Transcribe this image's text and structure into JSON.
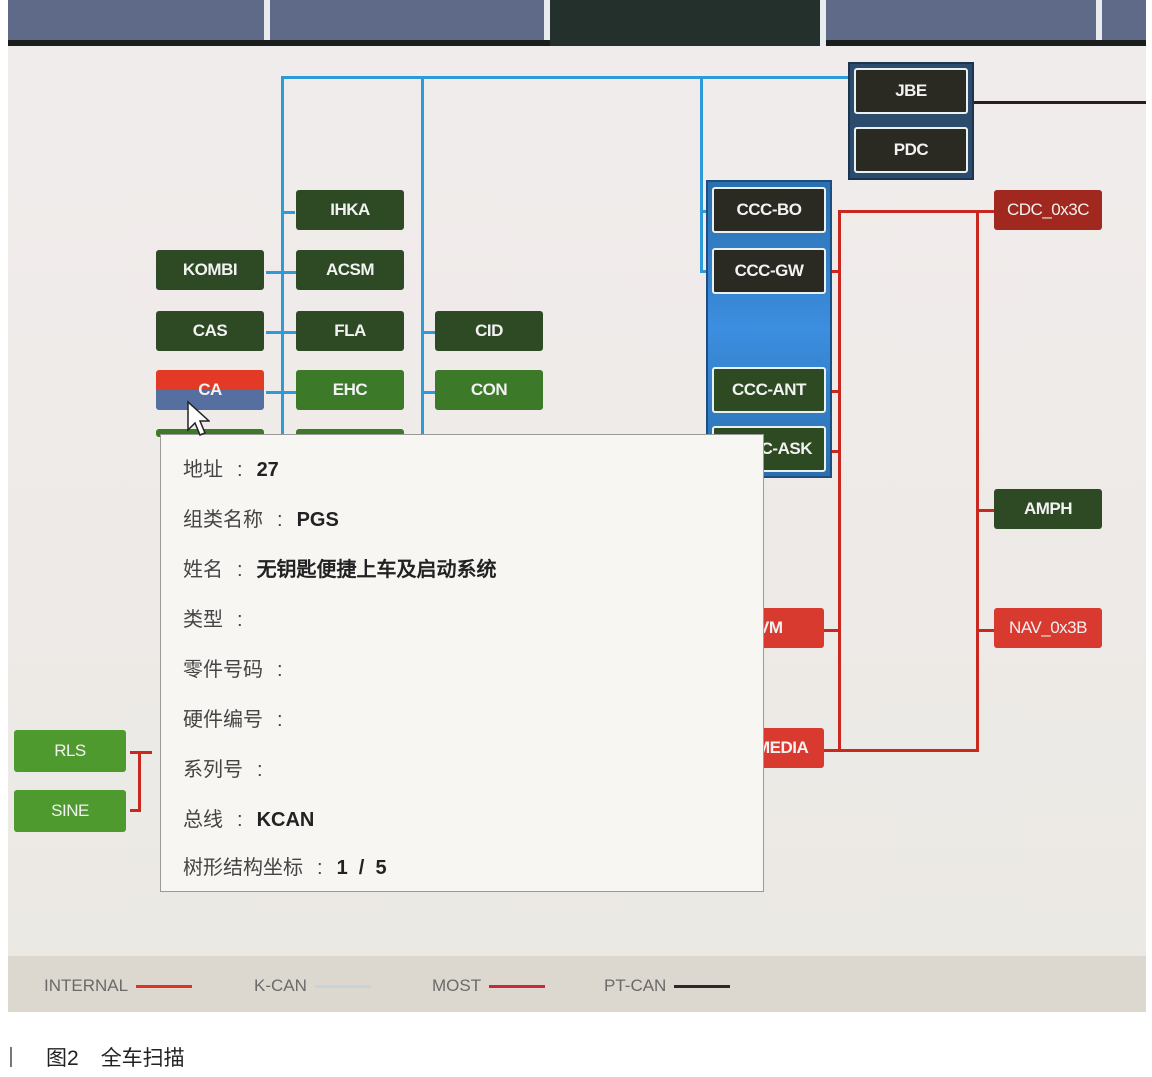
{
  "tabs": [
    {
      "label": "",
      "active": false
    },
    {
      "label": "",
      "active": false
    },
    {
      "label": "",
      "active": true
    },
    {
      "label": "",
      "active": false
    },
    {
      "label": "",
      "active": false
    }
  ],
  "modules": {
    "jbe": "JBE",
    "pdc": "PDC",
    "ihka": "IHKA",
    "kombi": "KOMBI",
    "acsm": "ACSM",
    "cas": "CAS",
    "fla": "FLA",
    "cid": "CID",
    "ca": "CA",
    "ehc": "EHC",
    "con": "CON",
    "ccc_bo": "CCC-BO",
    "ccc_gw": "CCC-GW",
    "ccc_ant": "CCC-ANT",
    "ccc_ask": "C-ASK",
    "cdc": "CDC_0x3C",
    "amph": "AMPH",
    "vm": "VM",
    "nav": "NAV_0x3B",
    "media": "MEDIA",
    "rls": "RLS",
    "sine": "SINE"
  },
  "tooltip": {
    "address": {
      "key": "地址",
      "value": "27"
    },
    "group_name": {
      "key": "组类名称",
      "value": "PGS"
    },
    "name": {
      "key": "姓名",
      "value": "无钥匙便捷上车及启动系统"
    },
    "type": {
      "key": "类型",
      "value": ""
    },
    "part_number": {
      "key": "零件号码",
      "value": ""
    },
    "hardware_number": {
      "key": "硬件编号",
      "value": ""
    },
    "serial_number": {
      "key": "系列号",
      "value": ""
    },
    "bus": {
      "key": "总线",
      "value": "KCAN"
    },
    "tree_coord": {
      "key": "树形结构坐标",
      "value": "1  /  5"
    },
    "separator": ":"
  },
  "legend": [
    {
      "label": "INTERNAL",
      "color": "#e0302a"
    },
    {
      "label": "K-CAN",
      "color": "#2f9ad8"
    },
    {
      "label": "MOST",
      "color": "#c8283a"
    },
    {
      "label": "PT-CAN",
      "color": "#2a2a2a"
    }
  ],
  "caption": {
    "figure": "图2",
    "title": "全车扫描"
  }
}
